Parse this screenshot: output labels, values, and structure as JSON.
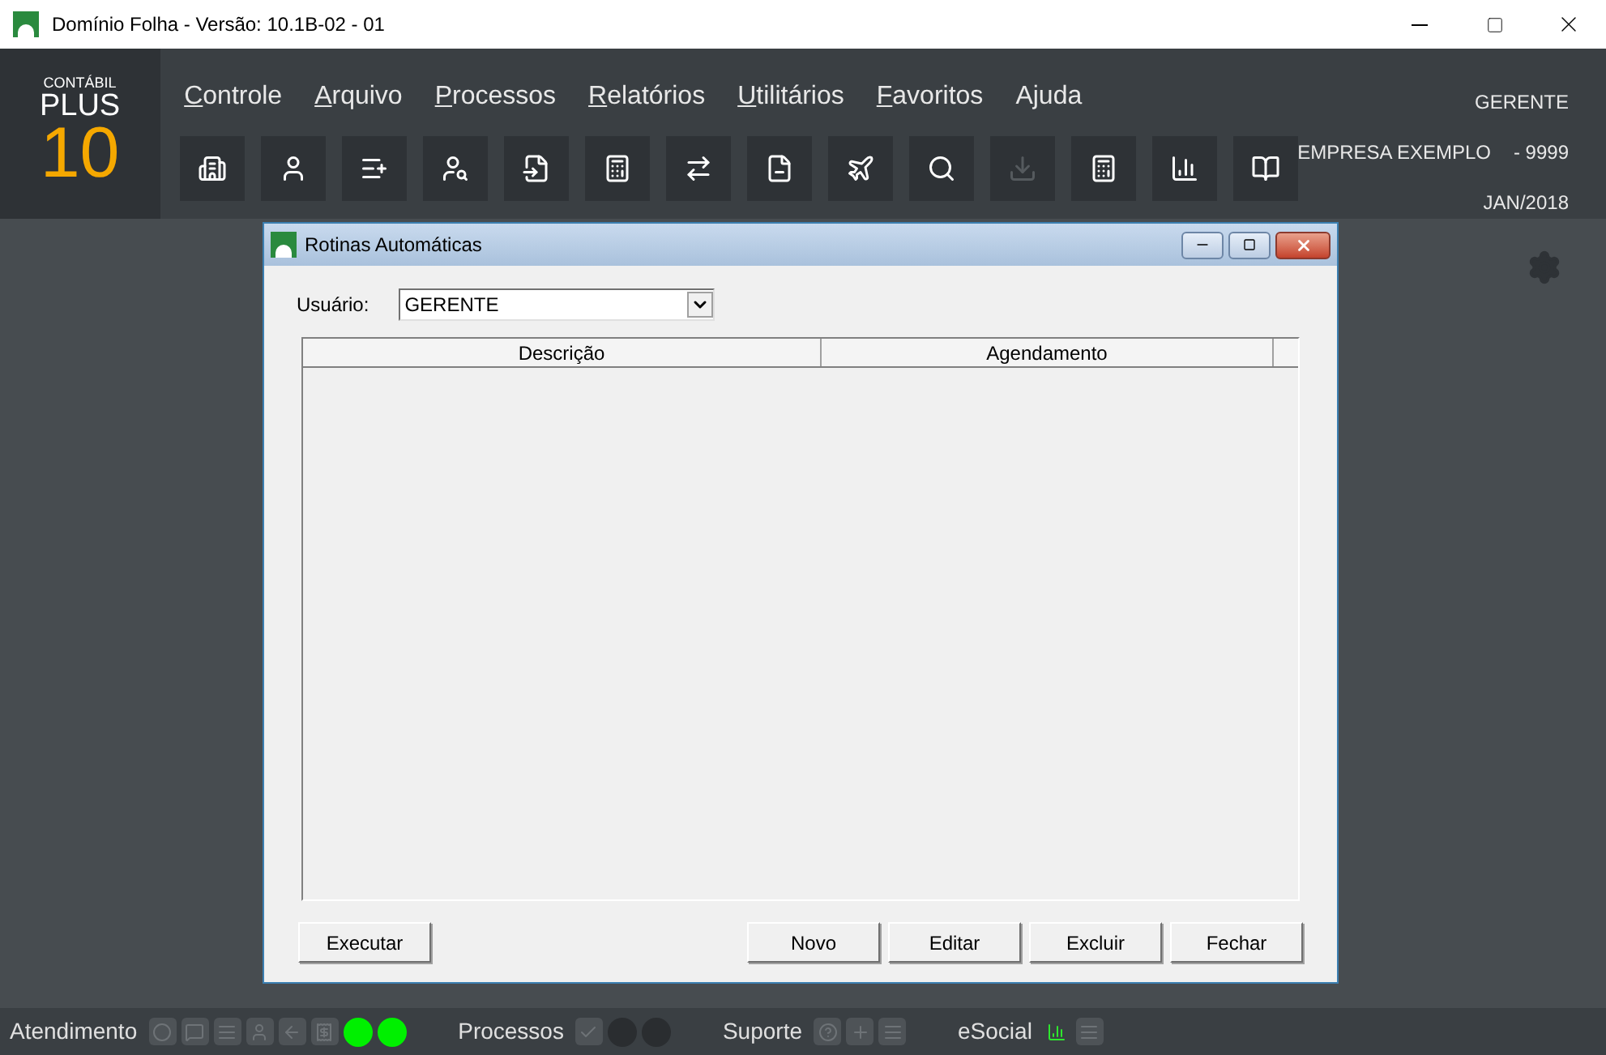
{
  "window": {
    "title": "Domínio Folha - Versão: 10.1B-02 - 01"
  },
  "logo": {
    "line_1": "CONTÁBIL",
    "line_2": "PLUS",
    "line_3": "10"
  },
  "menu": [
    {
      "label": "Controle",
      "underlined": true
    },
    {
      "label": "Arquivo",
      "underlined": true
    },
    {
      "label": "Processos",
      "underlined": true
    },
    {
      "label": "Relatórios",
      "underlined": true
    },
    {
      "label": "Utilitários",
      "underlined": true
    },
    {
      "label": "Favoritos",
      "underlined": true
    },
    {
      "label": "Ajuda",
      "underlined": false
    }
  ],
  "toolbar": [
    {
      "disabled": false
    },
    {
      "disabled": false
    },
    {
      "disabled": false
    },
    {
      "disabled": false
    },
    {
      "disabled": false
    },
    {
      "disabled": false
    },
    {
      "disabled": false
    },
    {
      "disabled": false
    },
    {
      "disabled": false
    },
    {
      "disabled": false
    },
    {
      "disabled": true
    },
    {
      "disabled": false
    },
    {
      "disabled": false
    },
    {
      "disabled": false
    }
  ],
  "session": {
    "user": "GERENTE",
    "company": "EMPRESA EXEMPLO",
    "company_code": "- 9999",
    "period": "JAN/2018"
  },
  "dialog": {
    "title": "Rotinas Automáticas",
    "user_label": "Usuário:",
    "user_value": "GERENTE",
    "columns": [
      "Descrição",
      "Agendamento"
    ],
    "buttons_left": [
      "Executar"
    ],
    "buttons_right": [
      "Novo",
      "Editar",
      "Excluir",
      "Fechar"
    ]
  },
  "status_bar": [
    {
      "label": "Atendimento",
      "lights": [
        {
          "on": true
        },
        {
          "on": true
        }
      ]
    },
    {
      "label": "Processos",
      "lights": [
        {
          "on": false
        },
        {
          "on": false
        }
      ]
    },
    {
      "label": "Suporte"
    },
    {
      "label": "eSocial"
    }
  ]
}
